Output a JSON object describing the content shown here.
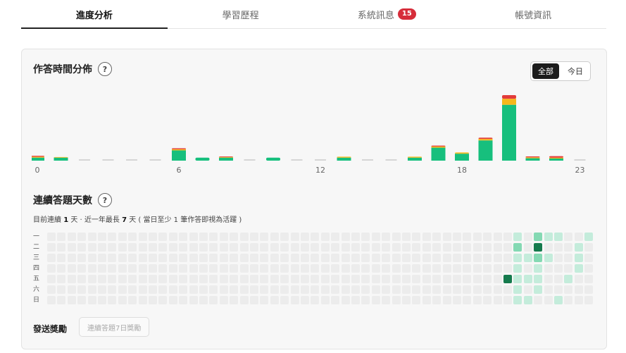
{
  "tabs": [
    {
      "label": "進度分析",
      "active": true
    },
    {
      "label": "學習歷程",
      "active": false
    },
    {
      "label": "系統訊息",
      "active": false,
      "badge": "15"
    },
    {
      "label": "帳號資訊",
      "active": false
    }
  ],
  "time_section": {
    "title": "作答時間分佈",
    "help": "?",
    "toggle": {
      "all": "全部",
      "today": "今日",
      "selected": "全部"
    }
  },
  "colors": {
    "green": "#17bf7d",
    "yellow": "#f6b81b",
    "red": "#e23b3b",
    "empty": "#d6d6d6",
    "heat_empty": "#ececec",
    "heat_light": "#c4ecdb",
    "heat_mid": "#84d9b3",
    "heat_dark": "#157a4d"
  },
  "chart_data": {
    "type": "bar",
    "stacked": true,
    "categories": [
      "0",
      "1",
      "2",
      "3",
      "4",
      "5",
      "6",
      "7",
      "8",
      "9",
      "10",
      "11",
      "12",
      "13",
      "14",
      "15",
      "16",
      "17",
      "18",
      "19",
      "20",
      "21",
      "22",
      "23"
    ],
    "x_tick_labels": [
      "0",
      "6",
      "12",
      "18",
      "23"
    ],
    "series": [
      {
        "color": "#17bf7d",
        "values": [
          1,
          1,
          0,
          0,
          0,
          0,
          3.4,
          1,
          1,
          0,
          1,
          0,
          0,
          1,
          0,
          0,
          1,
          4.3,
          2.3,
          6.7,
          18.5,
          0.8,
          0.7,
          0
        ]
      },
      {
        "color": "#f6b81b",
        "values": [
          0.3,
          0.2,
          0,
          0,
          0,
          0,
          0.4,
          0,
          0.2,
          0,
          0,
          0,
          0,
          0.3,
          0,
          0,
          0.3,
          0.4,
          0.4,
          0.5,
          2.0,
          0.3,
          0.3,
          0
        ]
      },
      {
        "color": "#e23b3b",
        "values": [
          0.3,
          0,
          0,
          0,
          0,
          0,
          0.3,
          0,
          0.2,
          0,
          0,
          0,
          0,
          0,
          0,
          0,
          0,
          0.3,
          0,
          0.4,
          1.2,
          0.3,
          0.5,
          0
        ]
      }
    ]
  },
  "streak_section": {
    "title": "連續答題天數",
    "help": "?",
    "summary_prefix": "目前連續",
    "current": "1",
    "summary_mid": "天 · 近一年最長",
    "longest": "7",
    "summary_suffix": "天 ( 當日至少 1 筆作答即視為活躍 )",
    "day_labels": [
      "一",
      "二",
      "三",
      "四",
      "五",
      "六",
      "日"
    ],
    "weeks": 52,
    "active_cells": [
      {
        "week": 45,
        "day": 4,
        "level": 3
      },
      {
        "week": 46,
        "day": 0,
        "level": 1
      },
      {
        "week": 46,
        "day": 1,
        "level": 2
      },
      {
        "week": 46,
        "day": 2,
        "level": 1
      },
      {
        "week": 46,
        "day": 3,
        "level": 1
      },
      {
        "week": 46,
        "day": 4,
        "level": 1
      },
      {
        "week": 46,
        "day": 5,
        "level": 1
      },
      {
        "week": 46,
        "day": 6,
        "level": 1
      },
      {
        "week": 47,
        "day": 2,
        "level": 1
      },
      {
        "week": 47,
        "day": 4,
        "level": 1
      },
      {
        "week": 47,
        "day": 6,
        "level": 1
      },
      {
        "week": 48,
        "day": 0,
        "level": 2
      },
      {
        "week": 48,
        "day": 1,
        "level": 3
      },
      {
        "week": 48,
        "day": 2,
        "level": 2
      },
      {
        "week": 48,
        "day": 3,
        "level": 1
      },
      {
        "week": 48,
        "day": 4,
        "level": 1
      },
      {
        "week": 48,
        "day": 5,
        "level": 1
      },
      {
        "week": 49,
        "day": 0,
        "level": 1
      },
      {
        "week": 49,
        "day": 2,
        "level": 1
      },
      {
        "week": 50,
        "day": 0,
        "level": 1
      },
      {
        "week": 50,
        "day": 6,
        "level": 1
      },
      {
        "week": 51,
        "day": 4,
        "level": 1
      },
      {
        "week": 52,
        "day": 1,
        "level": 1
      },
      {
        "week": 52,
        "day": 2,
        "level": 1
      },
      {
        "week": 52,
        "day": 3,
        "level": 1
      },
      {
        "week": 53,
        "day": 0,
        "level": 1
      }
    ]
  },
  "reward": {
    "label": "發送獎勵",
    "button": "連續答題7日獎勵"
  }
}
